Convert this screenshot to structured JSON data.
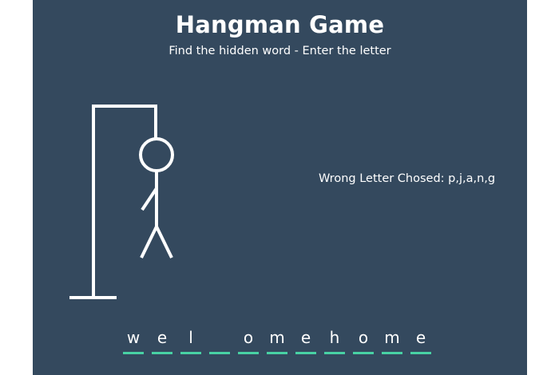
{
  "header": {
    "title": "Hangman Game",
    "subtitle": "Find the hidden word - Enter the letter"
  },
  "wrong_letters": {
    "text": "Wrong Letter Chosed: p,j,a,n,g"
  },
  "word": {
    "letters": [
      "w",
      "e",
      "l",
      "",
      "o",
      "m",
      "e",
      "h",
      "o",
      "m",
      "e"
    ]
  },
  "colors": {
    "background": "#34495e",
    "underline": "#48d1a4",
    "figure": "#ffffff"
  },
  "figure_parts_shown": [
    "gallows",
    "head",
    "body",
    "left-arm",
    "left-leg",
    "right-leg"
  ]
}
